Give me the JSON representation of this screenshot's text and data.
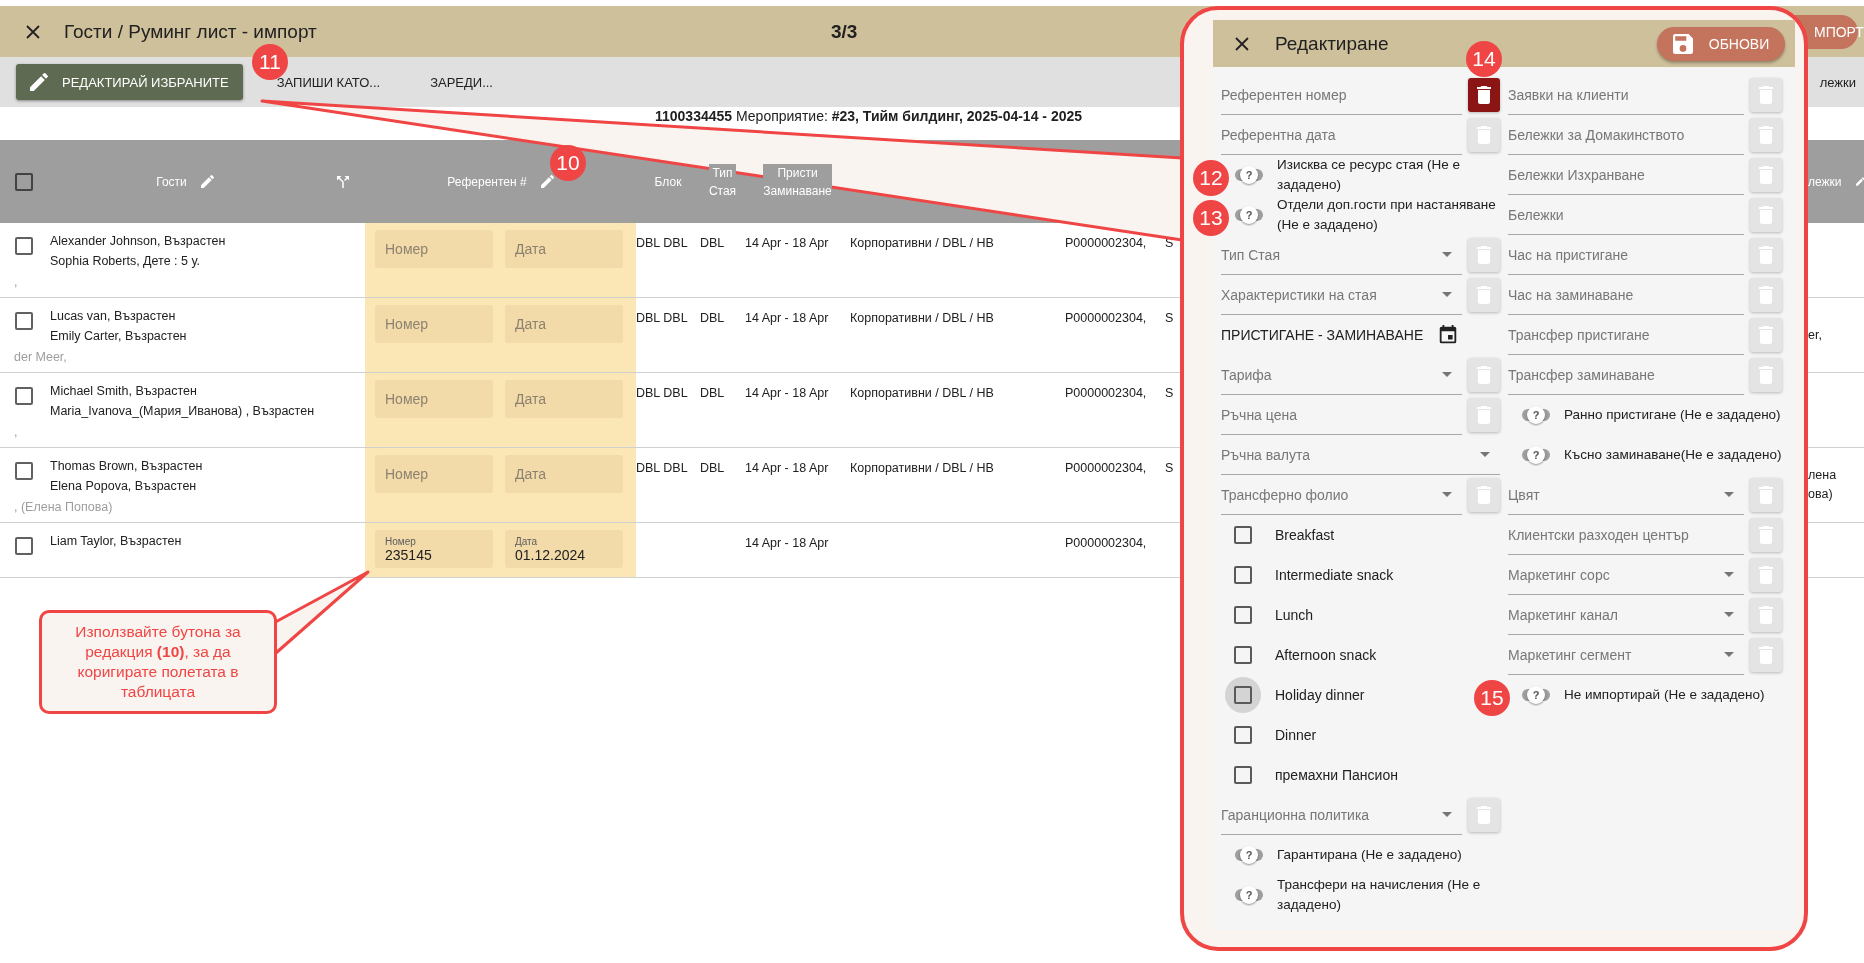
{
  "window": {
    "title": "Гости / Руминг лист - импорт",
    "step": "3/3",
    "import_button": "МПОРТ"
  },
  "toolbar": {
    "buttons": [
      {
        "label": "РЕДАКТИРАЙ ИЗБРАНИТЕ",
        "kind": "primary"
      },
      {
        "label": "ЗАПИШИ КАТО...",
        "kind": "flat"
      },
      {
        "label": "ЗАРЕДИ...",
        "kind": "flat"
      }
    ],
    "right_text": "лежки"
  },
  "info": "**1100334455**  Мероприятие: **#23, Тийм билдинг, 2025-04-14 - 2025**",
  "table": {
    "select_all": {
      "checked": false
    },
    "columns": [
      {
        "kind": "text",
        "lines": [
          "Гости"
        ],
        "editable": true
      },
      {
        "kind": "icon"
      },
      {
        "kind": "text",
        "lines": [
          "Референтен #"
        ],
        "editable": true
      },
      {
        "kind": "text",
        "lines": [
          "Блок"
        ],
        "editable": false
      },
      {
        "kind": "text",
        "lines": [
          "Тип",
          "Стая"
        ],
        "editable": false
      },
      {
        "kind": "text",
        "lines": [
          "Присти",
          "Заминаване"
        ],
        "editable": false
      },
      {
        "kind": "text",
        "lines": [
          "лежки"
        ],
        "editable": true
      }
    ],
    "rows": [
      {
        "checked": false,
        "guests": [
          "Alexander Johnson, Възрастен",
          "Sophia Roberts, Дете : 5 у."
        ],
        "note": ",",
        "ref_number": {
          "placeholder": "Номер"
        },
        "ref_date": {
          "placeholder": "Дата"
        },
        "block": "DBL DBL",
        "room_type": "DBL",
        "dates": "14 Apr - 18 Apr",
        "rate": "Корпоративни / DBL / HB",
        "code": "P0000002304,",
        "column_10": "S"
      },
      {
        "checked": false,
        "guests": [
          "Lucas van, Възрастен",
          "Emily Carter, Възрастен"
        ],
        "note": "der Meer,",
        "ref_number": {
          "placeholder": "Номер"
        },
        "ref_date": {
          "placeholder": "Дата"
        },
        "block": "DBL DBL",
        "room_type": "DBL",
        "dates": "14 Apr - 18 Apr",
        "rate": "Корпоративни / DBL / HB",
        "code": "P0000002304,",
        "column_10": "S",
        "column_11": [
          "er,"
        ]
      },
      {
        "checked": false,
        "guests": [
          "Michael Smith, Възрастен",
          "Maria_Ivanova_(Мария_Иванова) , Възрастен"
        ],
        "note": ",",
        "ref_number": {
          "placeholder": "Номер"
        },
        "ref_date": {
          "placeholder": "Дата"
        },
        "block": "DBL DBL",
        "room_type": "DBL",
        "dates": "14 Apr - 18 Apr",
        "rate": "Корпоративни / DBL / HB",
        "code": "P0000002304,",
        "column_10": "S"
      },
      {
        "checked": false,
        "guests": [
          "Thomas Brown, Възрастен",
          "Elena Popova, Възрастен"
        ],
        "note": ", (Елена Попова)",
        "ref_number": {
          "placeholder": "Номер"
        },
        "ref_date": {
          "placeholder": "Дата"
        },
        "block": "DBL DBL",
        "room_type": "DBL",
        "dates": "14 Apr - 18 Apr",
        "rate": "Корпоративни / DBL / HB",
        "code": "P0000002304,",
        "column_10": "S",
        "column_11": [
          "лена",
          "ова)"
        ]
      },
      {
        "checked": false,
        "guests": [
          "Liam Taylor, Възрастен"
        ],
        "ref_number": {
          "label": "Номер",
          "value": "235145"
        },
        "ref_date": {
          "label": "Дата",
          "value": "01.12.2024"
        },
        "dates": "14 Apr - 18 Apr",
        "code": "P0000002304,"
      }
    ]
  },
  "edit_panel": {
    "title": "Редактиране",
    "save_button": "ОБНОВИ",
    "left_column": [
      {
        "kind": "field",
        "label": "Референтен номер",
        "clear_active": true
      },
      {
        "kind": "field",
        "label": "Референтна дата",
        "clear_active": false
      },
      {
        "kind": "toggle",
        "label": "Изисква се ресурс стая (Не е зададено)",
        "set": false,
        "knob": "?"
      },
      {
        "kind": "toggle",
        "label": "Отдели доп.гости при настаняване (Не е зададено)",
        "set": false,
        "knob": "?"
      },
      {
        "kind": "select",
        "label": "Тип Стая",
        "clear_active": false
      },
      {
        "kind": "select",
        "label": "Характеристики на стая",
        "clear_active": false
      },
      {
        "kind": "date",
        "label": "ПРИСТИГАНЕ - ЗАМИНАВАНЕ"
      },
      {
        "kind": "select",
        "label": "Тарифа",
        "clear_active": false
      },
      {
        "kind": "field",
        "label": "Ръчна цена",
        "clear_active": false
      },
      {
        "kind": "select",
        "label": "Ръчна валута"
      },
      {
        "kind": "select",
        "label": "Трансферно фолио",
        "clear_active": false
      },
      {
        "kind": "checkbox",
        "label": "Breakfast",
        "checked": false,
        "focused": false
      },
      {
        "kind": "checkbox",
        "label": "Intermediate snack",
        "checked": false,
        "focused": false
      },
      {
        "kind": "checkbox",
        "label": "Lunch",
        "checked": false,
        "focused": false
      },
      {
        "kind": "checkbox",
        "label": "Afternoon snack",
        "checked": false,
        "focused": false
      },
      {
        "kind": "checkbox",
        "label": "Holiday dinner",
        "checked": false,
        "focused": true
      },
      {
        "kind": "checkbox",
        "label": "Dinner",
        "checked": false,
        "focused": false
      },
      {
        "kind": "checkbox",
        "label": "премахни Пансион",
        "checked": false,
        "focused": false
      },
      {
        "kind": "select",
        "label": "Гаранционна политика",
        "clear_active": false
      },
      {
        "kind": "toggle",
        "label": "Гарантирана (Не е зададено)",
        "set": false,
        "knob": "?"
      },
      {
        "kind": "toggle",
        "label": "Трансфери на начисления (Не е зададено)",
        "set": false,
        "knob": "?"
      }
    ],
    "right_column": [
      {
        "kind": "field",
        "label": "Заявки на клиенти",
        "clear_active": false
      },
      {
        "kind": "field",
        "label": "Бележки за Домакинството",
        "clear_active": false
      },
      {
        "kind": "field",
        "label": "Бележки Изхранване",
        "clear_active": false
      },
      {
        "kind": "field",
        "label": "Бележки",
        "clear_active": false
      },
      {
        "kind": "field",
        "label": "Час на пристигане",
        "clear_active": false
      },
      {
        "kind": "field",
        "label": "Час на заминаване",
        "clear_active": false
      },
      {
        "kind": "field",
        "label": "Трансфер пристигане",
        "clear_active": false
      },
      {
        "kind": "field",
        "label": "Трансфер заминаване",
        "clear_active": false
      },
      {
        "kind": "toggle",
        "label": "Ранно пристигане (Не е зададено)",
        "set": false,
        "knob": "?"
      },
      {
        "kind": "toggle",
        "label": "Късно заминаване(Не е зададено)",
        "set": false,
        "knob": "?"
      },
      {
        "kind": "select",
        "label": "Цвят",
        "clear_active": false
      },
      {
        "kind": "field",
        "label": "Клиентски разходен център",
        "clear_active": false
      },
      {
        "kind": "select",
        "label": "Маркетинг сорс",
        "clear_active": false
      },
      {
        "kind": "select",
        "label": "Маркетинг канал",
        "clear_active": false
      },
      {
        "kind": "select",
        "label": "Маркетинг сегмент",
        "clear_active": false
      },
      {
        "kind": "toggle",
        "label": "Не импортирай (Не е зададено)",
        "set": false,
        "knob": "?"
      }
    ]
  },
  "annotations": [
    {
      "number": "11"
    },
    {
      "number": "10"
    },
    {
      "number": "12"
    },
    {
      "number": "13"
    },
    {
      "number": "14"
    },
    {
      "number": "15"
    }
  ],
  "callout": "Използвайте бутона за редакция **(10)**, за да коригирате полетата в таблицата"
}
